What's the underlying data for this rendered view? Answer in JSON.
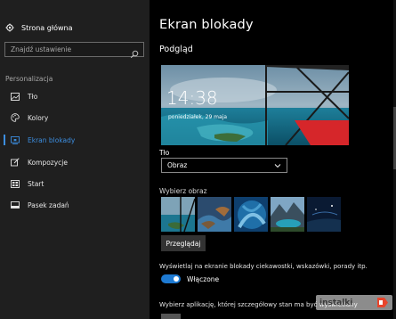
{
  "sidebar": {
    "home_label": "Strona główna",
    "search_placeholder": "Znajdź ustawienie",
    "section_title": "Personalizacja",
    "items": [
      {
        "label": "Tło",
        "icon": "image-icon"
      },
      {
        "label": "Kolory",
        "icon": "palette-icon"
      },
      {
        "label": "Ekran blokady",
        "icon": "lock-screen-icon",
        "active": true
      },
      {
        "label": "Kompozycje",
        "icon": "brush-icon"
      },
      {
        "label": "Start",
        "icon": "start-icon"
      },
      {
        "label": "Pasek zadań",
        "icon": "taskbar-icon"
      }
    ]
  },
  "main": {
    "title": "Ekran blokady",
    "preview_title": "Podgląd",
    "preview_time": "14:38",
    "preview_date": "poniedziałek, 29 maja",
    "background_label": "Tło",
    "background_value": "Obraz",
    "choose_label": "Wybierz obraz",
    "browse_label": "Przeglądaj",
    "fun_facts_label": "Wyświetlaj na ekranie blokady ciekawostki, wskazówki, porady itp.",
    "toggle_state": "Włączone",
    "toggle_on": true,
    "apps_label": "Wybierz aplikację, której szczegółowy stan ma być wyświetlany"
  },
  "watermark": "instalki",
  "colors": {
    "accent": "#3c8ee0",
    "toggle": "#1e7ad2",
    "sidebar_bg": "#1f1f1f",
    "main_bg": "#000000"
  }
}
